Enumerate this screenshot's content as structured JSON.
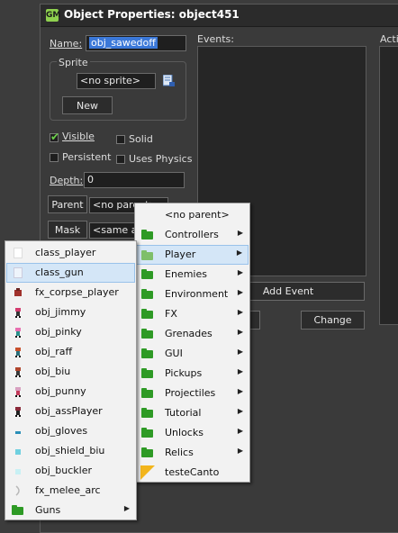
{
  "window": {
    "title": "Object Properties: object451"
  },
  "form": {
    "name_label": "Name:",
    "name_value": "obj_sawedoff",
    "sprite_group_label": "Sprite",
    "sprite_value": "<no sprite>",
    "new_button": "New",
    "visible_label": "Visible",
    "visible_checked": true,
    "solid_label": "Solid",
    "solid_checked": false,
    "persistent_label": "Persistent",
    "persistent_checked": false,
    "uses_physics_label": "Uses Physics",
    "uses_physics_checked": false,
    "depth_label": "Depth:",
    "depth_value": "0",
    "parent_button": "Parent",
    "parent_value": "<no parent>",
    "mask_button": "Mask",
    "mask_value": "<same as sprite>"
  },
  "events": {
    "label": "Events:",
    "add_event_button": "Add Event",
    "change_button": "Change"
  },
  "actions": {
    "label": "Actions"
  },
  "parent_menu": {
    "items": [
      {
        "label": "<no parent>",
        "icon": "none",
        "submenu": false
      },
      {
        "label": "Controllers",
        "icon": "folder-icon",
        "submenu": true
      },
      {
        "label": "Player",
        "icon": "folder-icon",
        "submenu": true,
        "highlighted": true
      },
      {
        "label": "Enemies",
        "icon": "folder-icon",
        "submenu": true
      },
      {
        "label": "Environment",
        "icon": "folder-icon",
        "submenu": true
      },
      {
        "label": "FX",
        "icon": "folder-icon",
        "submenu": true
      },
      {
        "label": "Grenades",
        "icon": "folder-icon",
        "submenu": true
      },
      {
        "label": "GUI",
        "icon": "folder-icon",
        "submenu": true
      },
      {
        "label": "Pickups",
        "icon": "folder-icon",
        "submenu": true
      },
      {
        "label": "Projectiles",
        "icon": "folder-icon",
        "submenu": true
      },
      {
        "label": "Tutorial",
        "icon": "folder-icon",
        "submenu": true
      },
      {
        "label": "Unlocks",
        "icon": "folder-icon",
        "submenu": true
      },
      {
        "label": "Relics",
        "icon": "folder-icon",
        "submenu": true
      },
      {
        "label": "testeCanto",
        "icon": "sprite-icon",
        "submenu": false
      }
    ]
  },
  "player_submenu": {
    "items": [
      {
        "label": "class_player",
        "icon": "blank-sprite-icon",
        "submenu": false
      },
      {
        "label": "class_gun",
        "icon": "blank-sprite-icon",
        "submenu": false,
        "highlighted": true
      },
      {
        "label": "fx_corpse_player",
        "icon": "corpse-sprite-icon",
        "submenu": false
      },
      {
        "label": "obj_jimmy",
        "icon": "character-sprite-icon",
        "submenu": false
      },
      {
        "label": "obj_pinky",
        "icon": "character-sprite-icon",
        "submenu": false
      },
      {
        "label": "obj_raff",
        "icon": "character-sprite-icon",
        "submenu": false
      },
      {
        "label": "obj_biu",
        "icon": "character-sprite-icon",
        "submenu": false
      },
      {
        "label": "obj_punny",
        "icon": "character-sprite-icon",
        "submenu": false
      },
      {
        "label": "obj_assPlayer",
        "icon": "character-sprite-icon",
        "submenu": false
      },
      {
        "label": "obj_gloves",
        "icon": "gloves-sprite-icon",
        "submenu": false
      },
      {
        "label": "obj_shield_biu",
        "icon": "shield-sprite-icon",
        "submenu": false
      },
      {
        "label": "obj_buckler",
        "icon": "buckler-sprite-icon",
        "submenu": false
      },
      {
        "label": "fx_melee_arc",
        "icon": "arc-sprite-icon",
        "submenu": false
      },
      {
        "label": "Guns",
        "icon": "folder-icon",
        "submenu": true
      }
    ]
  }
}
